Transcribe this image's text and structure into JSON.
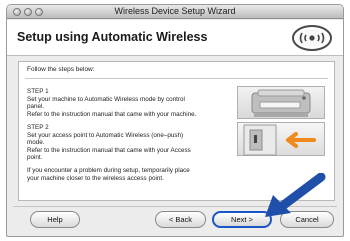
{
  "window": {
    "title": "Wireless Device Setup Wizard"
  },
  "header": {
    "title": "Setup using Automatic Wireless"
  },
  "content": {
    "intro": "Follow the steps below:",
    "step1_lines": [
      "STEP 1",
      "Set your machine to Automatic Wireless mode by control",
      "panel.",
      "Refer to the instruction manual that came with your machine."
    ],
    "step2_lines": [
      "STEP 2",
      "Set your access point to Automatic Wireless (one–push)",
      "mode.",
      "Refer to the instruction manual that came with your Access",
      "point."
    ],
    "note_lines": [
      "If you encounter a problem during setup, temporarily place",
      "your machine closer to the wireless access point."
    ]
  },
  "buttons": {
    "help": "Help",
    "back": "< Back",
    "next": "Next >",
    "cancel": "Cancel"
  },
  "colors": {
    "accent_arrow": "#1f4fa8",
    "step_arrow": "#f08a1c",
    "next_focus_ring": "#1a56c8"
  }
}
